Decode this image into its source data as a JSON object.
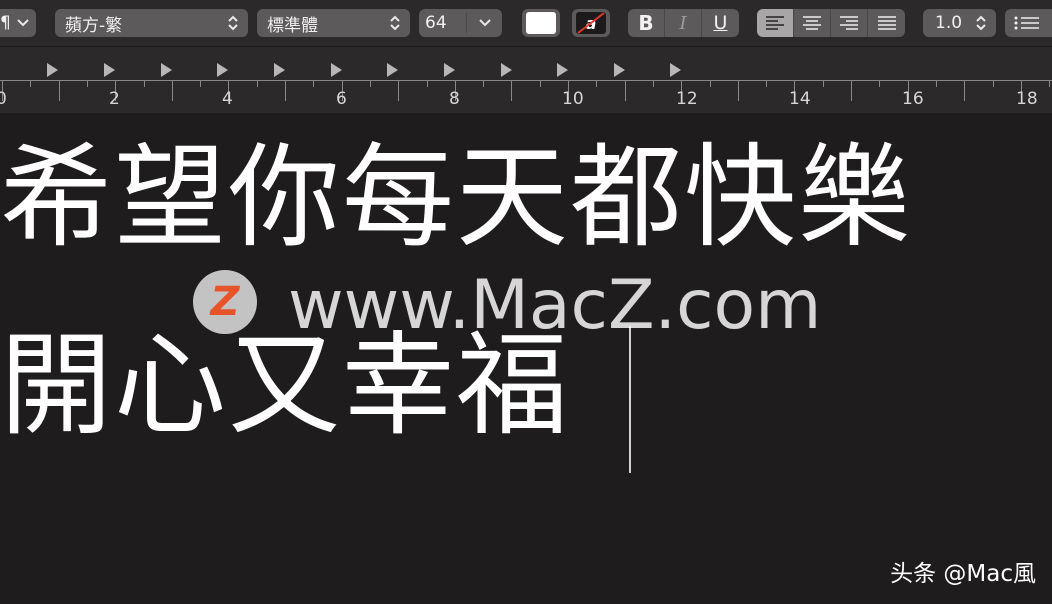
{
  "toolbar": {
    "paragraph_style_icon": "pilcrow-icon",
    "paragraph_symbol": "¶",
    "font_family": "蘋方-繁",
    "font_style": "標準體",
    "font_size": "64",
    "bold_label": "B",
    "italic_label": "I",
    "underline_label": "U",
    "text_color": "#ffffff",
    "highlight_label": "a",
    "line_spacing": "1.0",
    "alignment_options": [
      "align-left",
      "align-center",
      "align-right",
      "justify"
    ],
    "active_alignment": "align-left"
  },
  "ruler": {
    "labels": [
      "0",
      "2",
      "4",
      "6",
      "8",
      "10",
      "12",
      "14",
      "16",
      "18"
    ]
  },
  "document": {
    "line1": "希望你每天都快樂",
    "line2": "開心又幸福"
  },
  "watermark": {
    "logo_letter": "Z",
    "text": "www.MacZ.com"
  },
  "credit": "头条 @Mac風",
  "colors": {
    "toolbar_bg": "#2c292a",
    "control_bg": "#5d5a5b",
    "document_bg": "#1e1c1d",
    "watermark_logo": "#e8542a"
  }
}
